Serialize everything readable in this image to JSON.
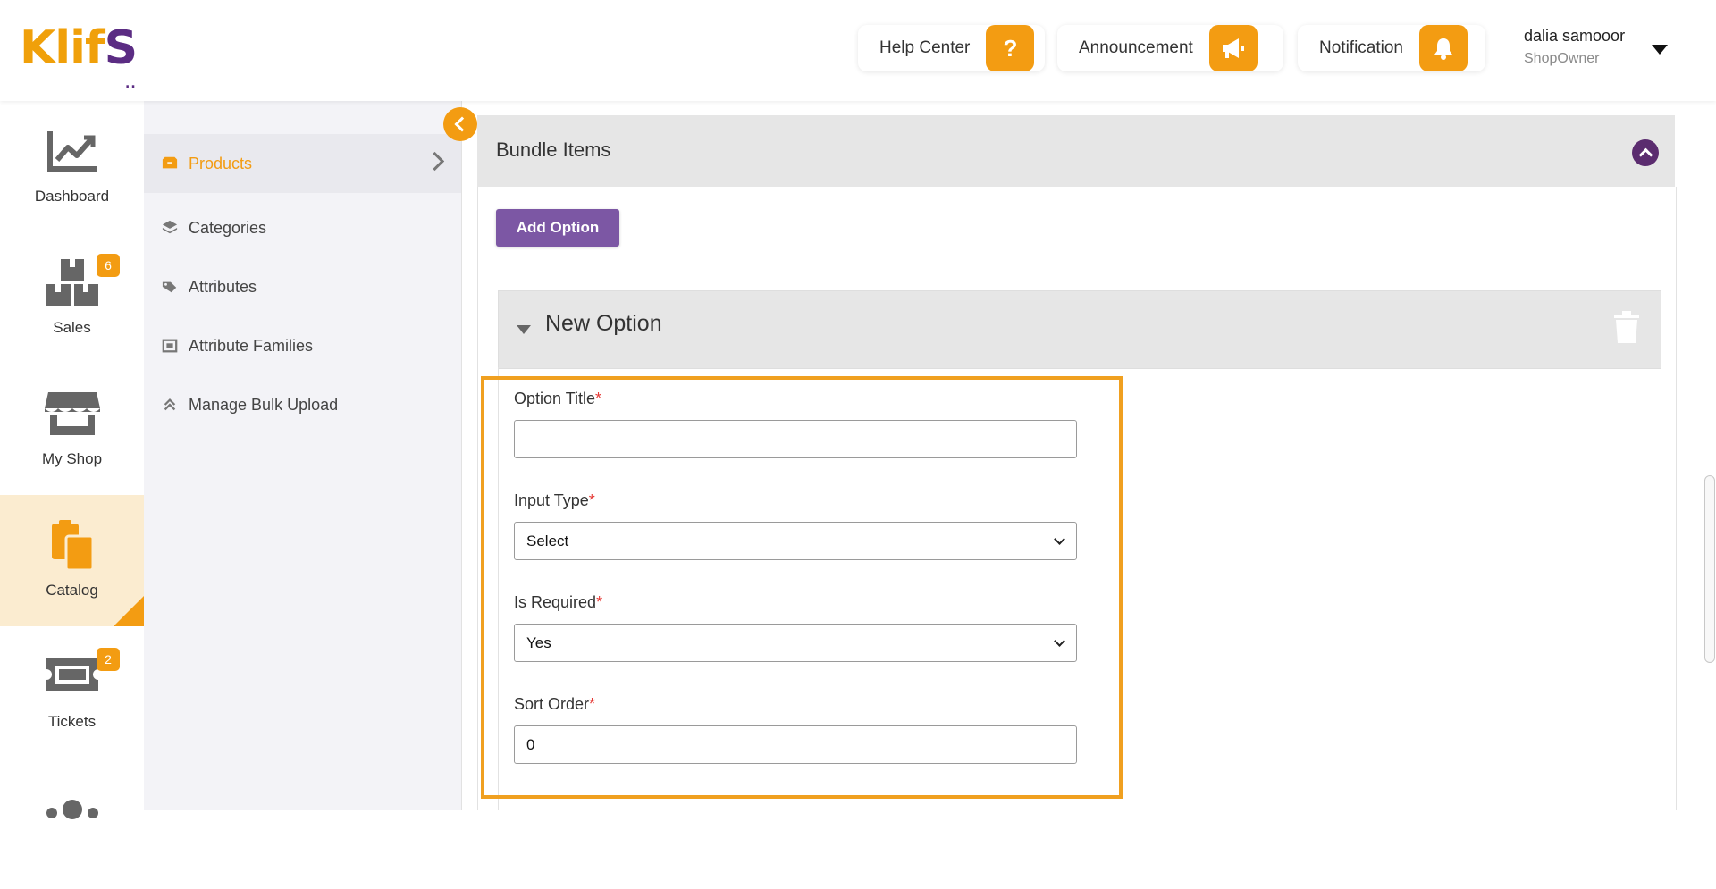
{
  "brand": {
    "logo_main": "Klif",
    "logo_accent": "S",
    "logo_dots": "..",
    "accent_color": "#f39c12",
    "purple": "#5b2c6f"
  },
  "header": {
    "help_label": "Help Center",
    "announcement_label": "Announcement",
    "notification_label": "Notification",
    "user_name": "dalia samooor",
    "user_role": "ShopOwner"
  },
  "rail": {
    "items": [
      {
        "label": "Dashboard",
        "icon": "chart-icon"
      },
      {
        "label": "Sales",
        "icon": "boxes-icon",
        "badge": "6"
      },
      {
        "label": "My Shop",
        "icon": "store-icon"
      },
      {
        "label": "Catalog",
        "icon": "clipboard-icon",
        "active": true
      },
      {
        "label": "Tickets",
        "icon": "ticket-icon",
        "badge": "2"
      }
    ]
  },
  "submenu": {
    "items": [
      {
        "label": "Products",
        "active": true
      },
      {
        "label": "Categories"
      },
      {
        "label": "Attributes"
      },
      {
        "label": "Attribute Families"
      },
      {
        "label": "Manage Bulk Upload"
      }
    ]
  },
  "section": {
    "title": "Bundle Items",
    "add_option_label": "Add Option",
    "option_title": "New Option"
  },
  "form": {
    "option_title_label": "Option Title",
    "option_title_value": "",
    "input_type_label": "Input Type",
    "input_type_value": "Select",
    "is_required_label": "Is Required",
    "is_required_value": "Yes",
    "sort_order_label": "Sort Order",
    "sort_order_value": "0",
    "required_mark": "*"
  }
}
